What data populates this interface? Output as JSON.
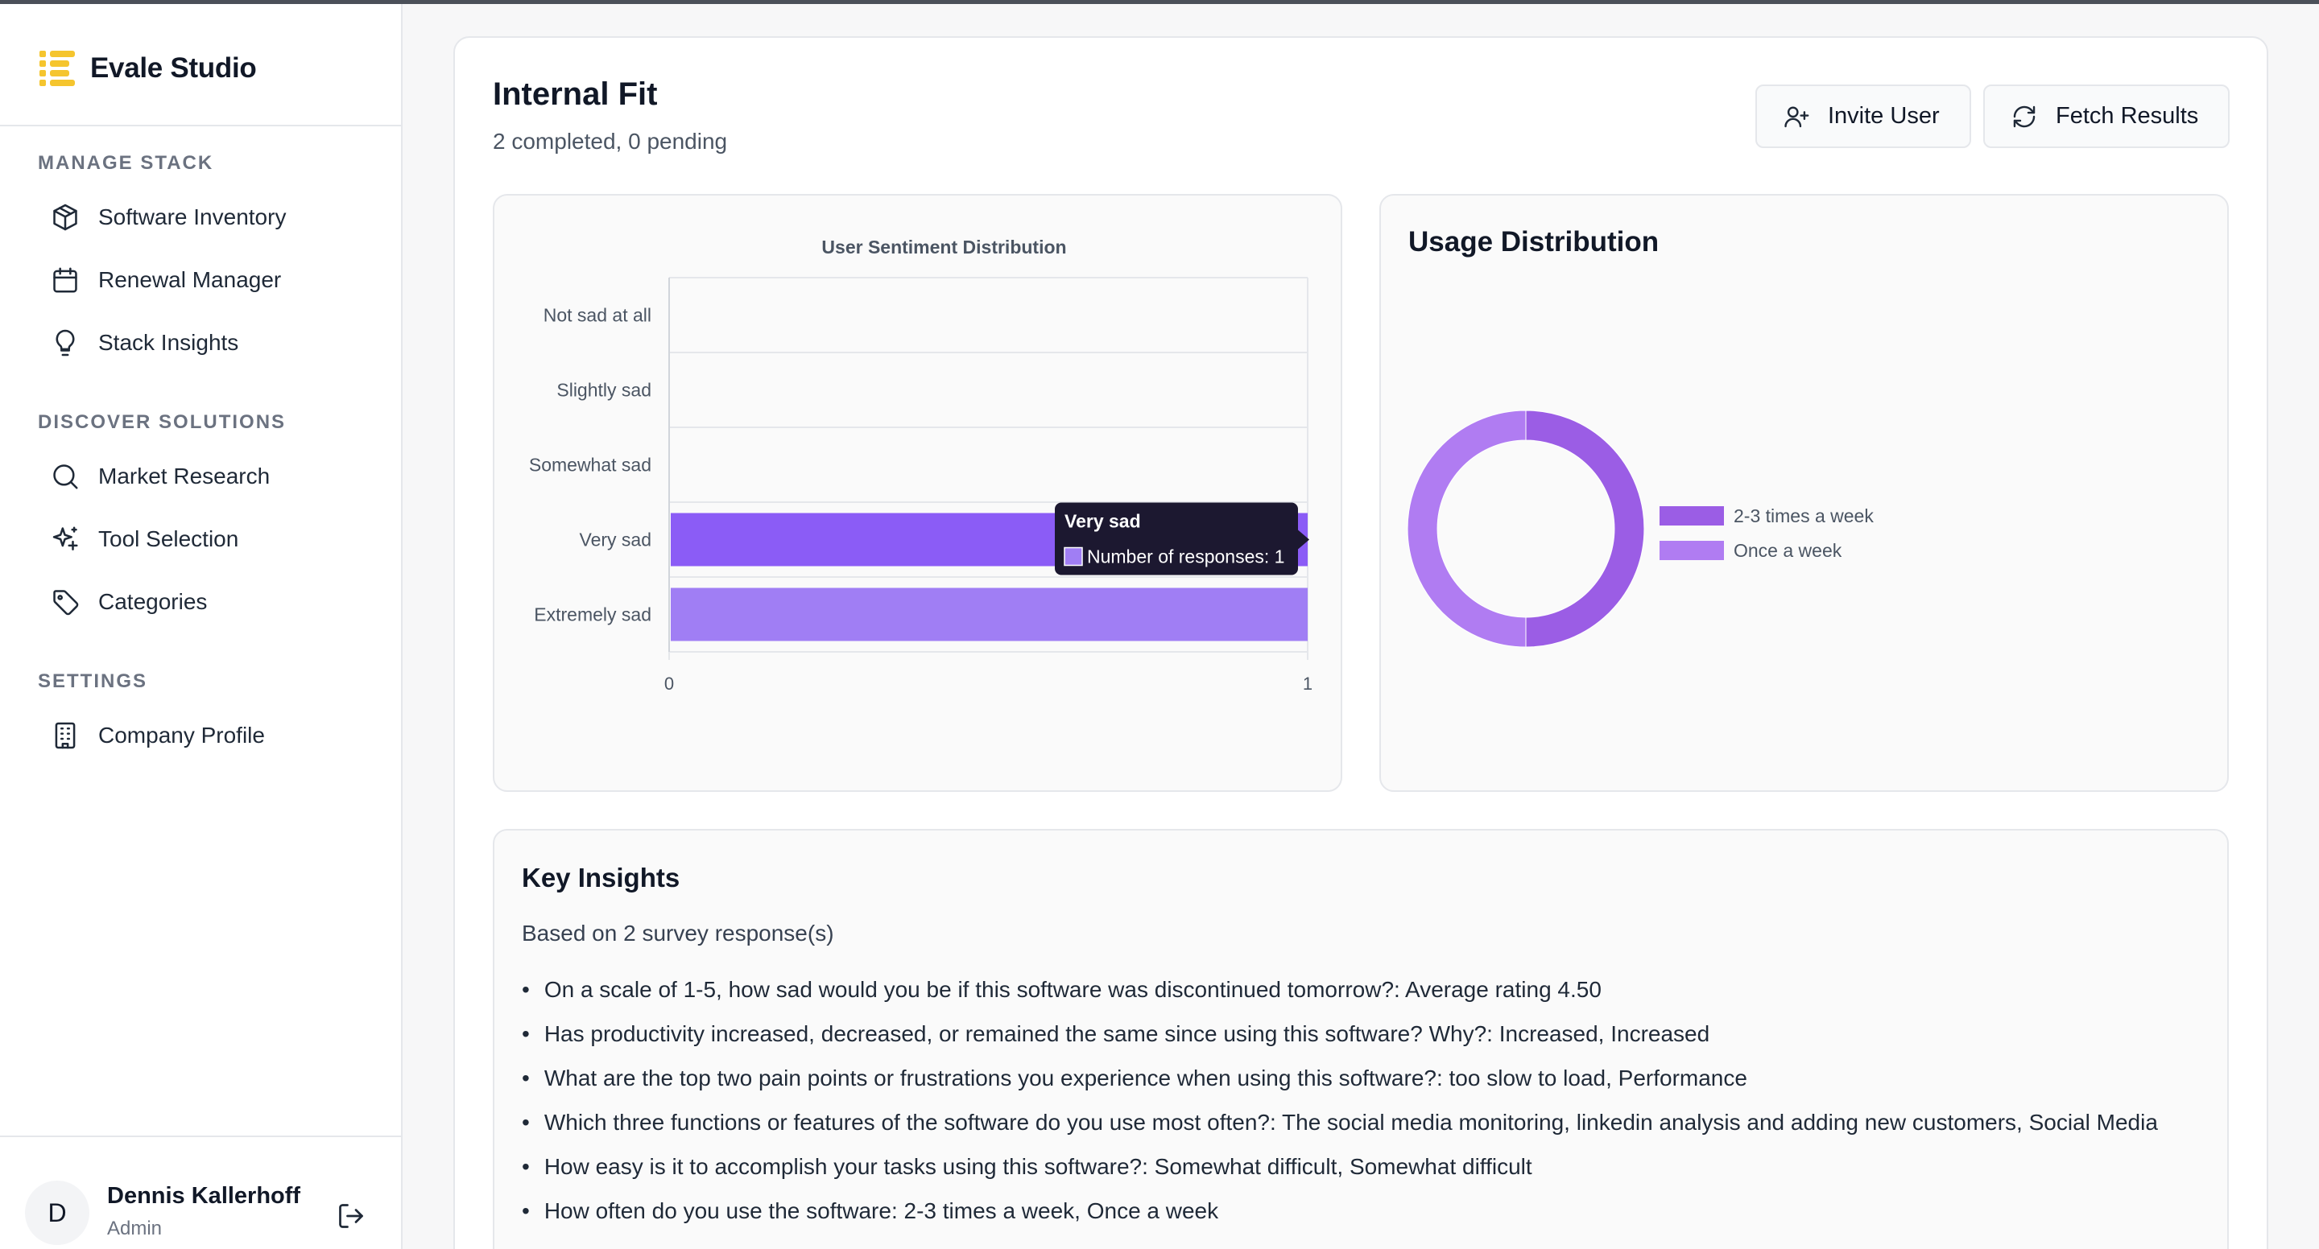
{
  "app": {
    "name": "Evale Studio"
  },
  "sidebar": {
    "sections": [
      {
        "title": "MANAGE STACK",
        "items": [
          "Software Inventory",
          "Renewal Manager",
          "Stack Insights"
        ]
      },
      {
        "title": "DISCOVER SOLUTIONS",
        "items": [
          "Market Research",
          "Tool Selection",
          "Categories"
        ]
      },
      {
        "title": "SETTINGS",
        "items": [
          "Company Profile"
        ]
      }
    ]
  },
  "user": {
    "initial": "D",
    "name": "Dennis Kallerhoff",
    "role": "Admin"
  },
  "page": {
    "title": "Internal Fit",
    "subtitle": "2 completed, 0 pending",
    "invite_label": "Invite User",
    "fetch_label": "Fetch Results"
  },
  "chart_data": [
    {
      "type": "bar",
      "orientation": "horizontal",
      "title": "User Sentiment Distribution",
      "categories": [
        "Not sad at all",
        "Slightly sad",
        "Somewhat sad",
        "Very sad",
        "Extremely sad"
      ],
      "series": [
        {
          "name": "Number of responses",
          "values": [
            0,
            0,
            0,
            1,
            1
          ]
        }
      ],
      "xlim": [
        0,
        1
      ],
      "x_ticks": [
        "0",
        "1"
      ],
      "grid": true,
      "colors": [
        "#8b5cf6",
        "#a07ef4"
      ],
      "tooltip": {
        "title": "Very sad",
        "label": "Number of responses: 1"
      }
    },
    {
      "type": "pie",
      "variant": "doughnut",
      "title": "Usage Distribution",
      "categories": [
        "2-3 times a week",
        "Once a week"
      ],
      "values": [
        1,
        1
      ],
      "colors": [
        "#9b5de5",
        "#b07cf2"
      ],
      "legend": "right"
    }
  ],
  "insights": {
    "title": "Key Insights",
    "intro": "Based on 2 survey response(s)",
    "items": [
      "On a scale of 1-5, how sad would you be if this software was discontinued tomorrow?: Average rating 4.50",
      "Has productivity increased, decreased, or remained the same since using this software? Why?: Increased, Increased",
      "What are the top two pain points or frustrations you experience when using this software?: too slow to load, Performance",
      "Which three functions or features of the software do you use most often?: The social media monitoring, linkedin analysis and adding new customers, Social Media",
      "How easy is it to accomplish your tasks using this software?: Somewhat difficult, Somewhat difficult",
      "How often do you use the software: 2-3 times a week, Once a week"
    ]
  }
}
